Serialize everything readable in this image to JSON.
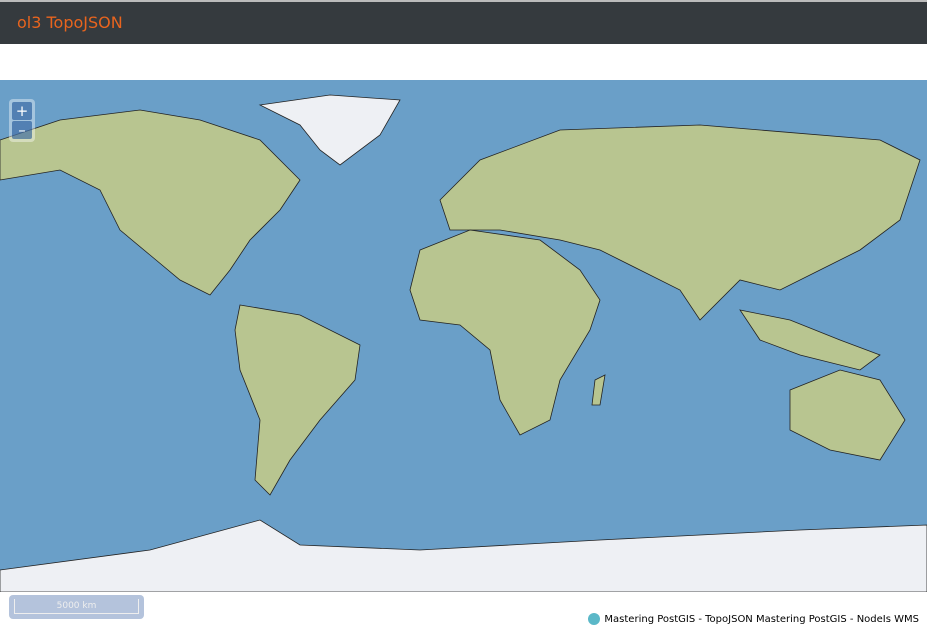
{
  "header": {
    "title": "ol3 TopoJSON"
  },
  "controls": {
    "zoom_in": "+",
    "zoom_out": "–"
  },
  "scale_line": {
    "label": "5000 km"
  },
  "attribution": {
    "icon": "globe-icon",
    "text": "Mastering PostGIS - TopoJSON Mastering PostGIS - NodeIs WMS"
  },
  "colors": {
    "header_bg": "#353a3e",
    "title": "#e8641e",
    "ocean": "#6a9fc8",
    "land": "#b8c590"
  }
}
